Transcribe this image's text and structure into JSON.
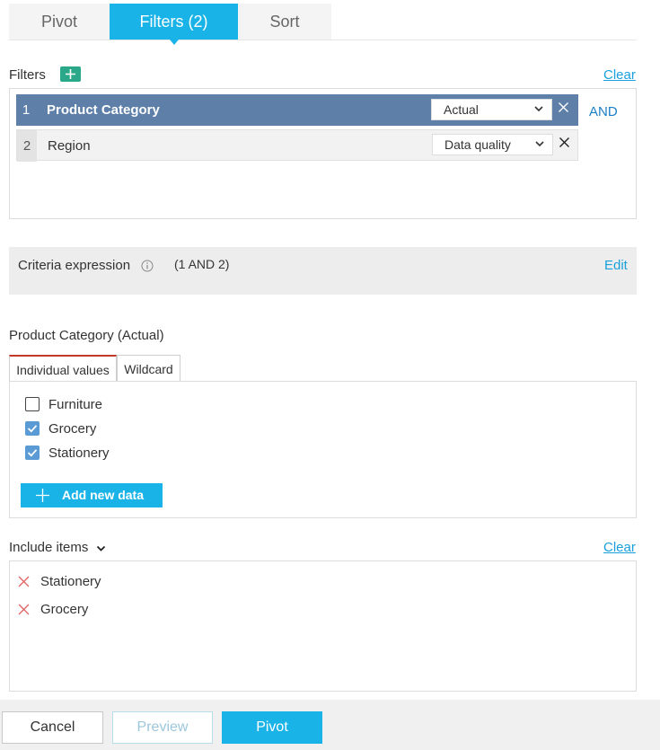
{
  "tabs": [
    {
      "label": "Pivot"
    },
    {
      "label": "Filters (2)",
      "active": true
    },
    {
      "label": "Sort"
    }
  ],
  "filters_section": {
    "title": "Filters",
    "clear_label": "Clear",
    "connector_label": "AND",
    "rows": [
      {
        "index": "1",
        "name": "Product Category",
        "select_value": "Actual",
        "active": true
      },
      {
        "index": "2",
        "name": "Region",
        "select_value": "Data quality",
        "active": false
      }
    ]
  },
  "criteria": {
    "label": "Criteria expression",
    "expression": "(1 AND 2)",
    "edit_label": "Edit"
  },
  "values_section": {
    "title": "Product Category (Actual)",
    "tabs": [
      {
        "label": "Individual values",
        "active": true
      },
      {
        "label": "Wildcard"
      }
    ],
    "items": [
      {
        "label": "Furniture",
        "checked": false
      },
      {
        "label": "Grocery",
        "checked": true
      },
      {
        "label": "Stationery",
        "checked": true
      }
    ],
    "add_label": "Add new data"
  },
  "include_section": {
    "title": "Include items",
    "clear_label": "Clear",
    "items": [
      {
        "label": "Stationery"
      },
      {
        "label": "Grocery"
      }
    ]
  },
  "footer": {
    "cancel_label": "Cancel",
    "preview_label": "Preview",
    "pivot_label": "Pivot"
  },
  "colors": {
    "accent": "#1ab3e8",
    "active_row": "#5d7fa8",
    "add_green": "#2aa889",
    "link": "#1aa0dc",
    "remove_red": "#e06666"
  },
  "icons": {
    "add": "plus-icon",
    "dropdown": "chevron-down-icon",
    "remove": "close-icon",
    "info": "info-icon",
    "check": "check-icon"
  }
}
